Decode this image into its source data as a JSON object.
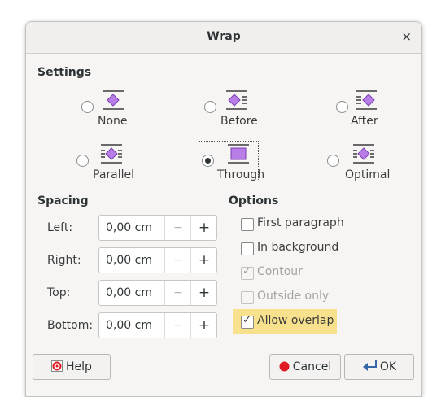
{
  "dialog": {
    "title": "Wrap",
    "close_glyph": "×"
  },
  "settings": {
    "heading": "Settings",
    "options": [
      {
        "label": "None",
        "icon": "wrap-none-icon",
        "selected": false
      },
      {
        "label": "Before",
        "icon": "wrap-before-icon",
        "selected": false
      },
      {
        "label": "After",
        "icon": "wrap-after-icon",
        "selected": false
      },
      {
        "label": "Parallel",
        "icon": "wrap-parallel-icon",
        "selected": false
      },
      {
        "label": "Through",
        "icon": "wrap-through-icon",
        "selected": true
      },
      {
        "label": "Optimal",
        "icon": "wrap-optimal-icon",
        "selected": false
      }
    ]
  },
  "spacing": {
    "heading": "Spacing",
    "fields": [
      {
        "label": "Left:",
        "value": "0,00 cm"
      },
      {
        "label": "Right:",
        "value": "0,00 cm"
      },
      {
        "label": "Top:",
        "value": "0,00 cm"
      },
      {
        "label": "Bottom:",
        "value": "0,00 cm"
      }
    ],
    "minus_glyph": "−",
    "plus_glyph": "+"
  },
  "options": {
    "heading": "Options",
    "items": [
      {
        "label": "First paragraph",
        "checked": false,
        "enabled": true
      },
      {
        "label": "In background",
        "checked": false,
        "enabled": true
      },
      {
        "label": "Contour",
        "checked": true,
        "enabled": false
      },
      {
        "label": "Outside only",
        "checked": false,
        "enabled": false
      },
      {
        "label": "Allow overlap",
        "checked": true,
        "enabled": true,
        "highlighted": true
      }
    ]
  },
  "buttons": {
    "help": "Help",
    "cancel": "Cancel",
    "ok": "OK"
  },
  "colors": {
    "accent": "#a64ee0",
    "highlight": "#f7e18c",
    "cancel_icon": "#e01b24"
  }
}
